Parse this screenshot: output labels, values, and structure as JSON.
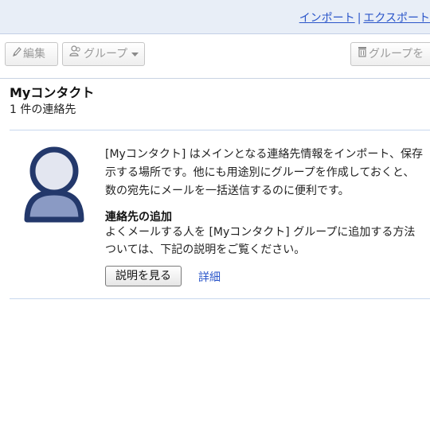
{
  "top_links": {
    "import": "インポート",
    "separator": "|",
    "export": "エクスポート"
  },
  "toolbar": {
    "edit": "編集",
    "group": "グループ",
    "delete_group": "グループを"
  },
  "header": {
    "title": "Myコンタクト",
    "count": "1 件の連絡先"
  },
  "intro": {
    "lines": [
      "[Myコンタクト] はメインとなる連絡先情報をインポート、保存",
      "示する場所です。他にも用途別にグループを作成しておくと、",
      "数の宛先にメールを一括送信するのに便利です。"
    ]
  },
  "add_section": {
    "title": "連絡先の追加",
    "lines": [
      "よくメールする人を [Myコンタクト] グループに追加する方法",
      "ついては、下記の説明をご覧ください。"
    ],
    "show_button": "説明を見る",
    "details_link": "詳細"
  },
  "colors": {
    "link": "#2a55c9",
    "topbar": "#e8eef7",
    "avatar_outline": "#23386b",
    "avatar_fill": "#e3e6f0"
  },
  "icons": {
    "edit": "pencil-icon",
    "group": "people-icon",
    "group_dropdown": "chevron-down-icon",
    "delete": "trash-icon"
  }
}
